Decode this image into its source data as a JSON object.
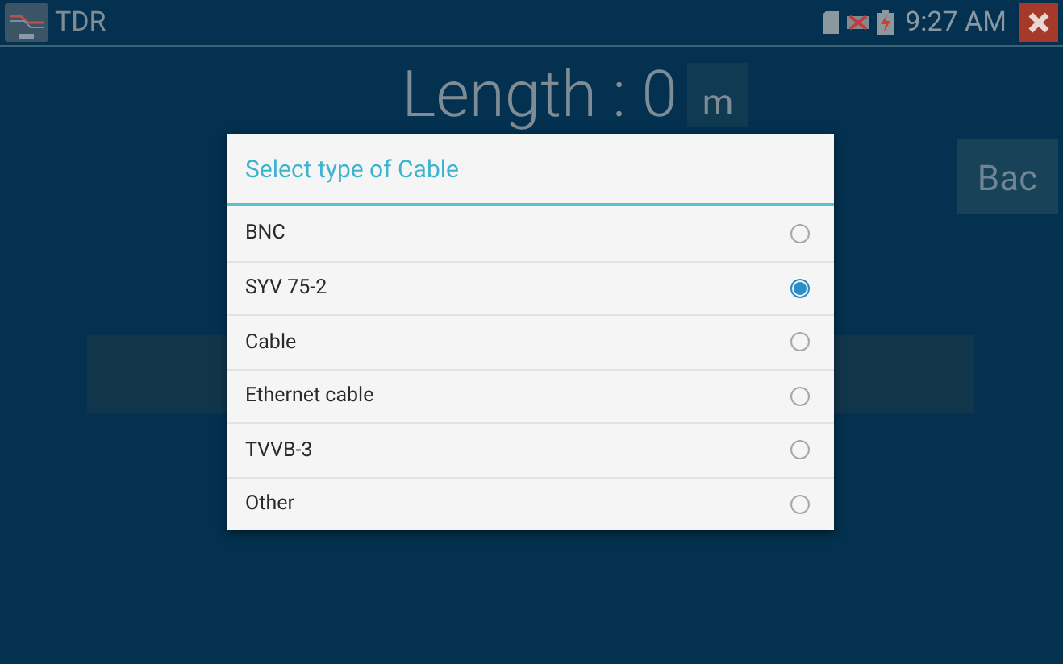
{
  "app_bar": {
    "title": "TDR",
    "time": "9:27 AM"
  },
  "measurement": {
    "reading": "Length : 0",
    "unit": "m"
  },
  "back_button": {
    "label": "Bac"
  },
  "dialog": {
    "title": "Select type of Cable",
    "options": [
      {
        "label": "BNC",
        "selected": false
      },
      {
        "label": "SYV 75-2",
        "selected": true
      },
      {
        "label": "Cable",
        "selected": false
      },
      {
        "label": "Ethernet cable",
        "selected": false
      },
      {
        "label": "TVVB-3",
        "selected": false
      },
      {
        "label": "Other",
        "selected": false
      }
    ]
  }
}
